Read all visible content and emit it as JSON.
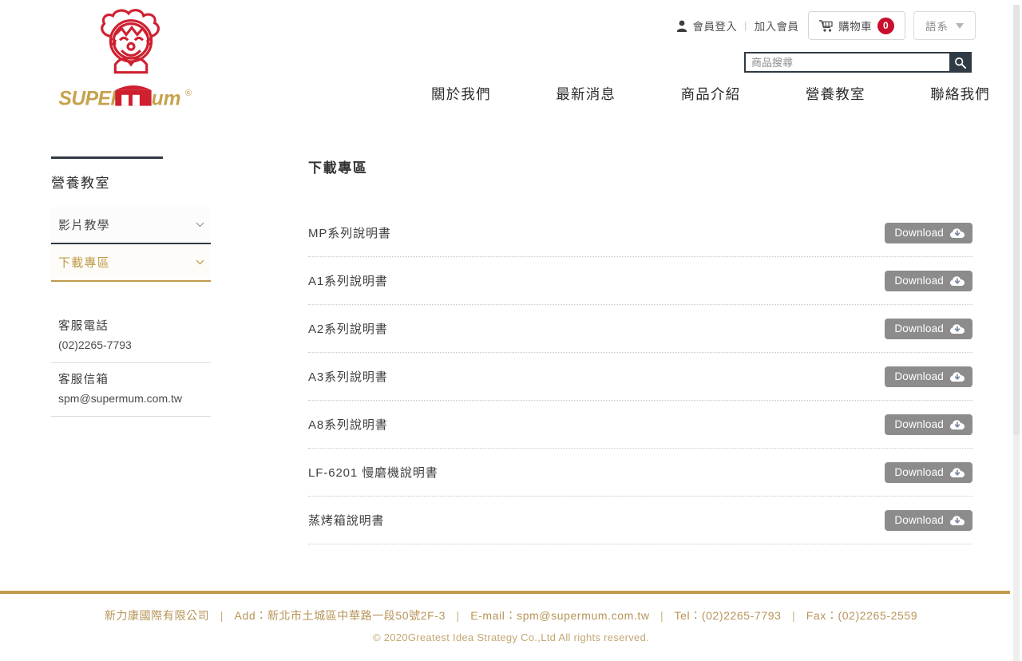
{
  "header": {
    "logo": {
      "brand": "SUPERMUM",
      "alt": "supermum-logo",
      "registered": "®"
    },
    "member": {
      "icon": "person-icon",
      "login_label": "會員登入",
      "separator": "|",
      "join_label": "加入會員"
    },
    "cart": {
      "icon": "cart-icon",
      "label": "購物車",
      "count": "0",
      "badge_color": "#c8102e"
    },
    "lang": {
      "label": "語系",
      "icon": "chevron-down-icon"
    },
    "search": {
      "placeholder": "商品搜尋",
      "value": "",
      "icon": "search-icon"
    },
    "nav": [
      {
        "label": "關於我們"
      },
      {
        "label": "最新消息"
      },
      {
        "label": "商品介紹"
      },
      {
        "label": "營養教室"
      },
      {
        "label": "聯絡我們"
      }
    ]
  },
  "sidebar": {
    "title": "營養教室",
    "accordion": [
      {
        "label": "影片教學",
        "active": false,
        "icon": "chevron-down-icon"
      },
      {
        "label": "下載專區",
        "active": true,
        "icon": "chevron-down-icon"
      }
    ],
    "contacts": [
      {
        "label": "客服電話",
        "value": "(02)2265-7793"
      },
      {
        "label": "客服信箱",
        "value": "spm@supermum.com.tw"
      }
    ]
  },
  "main": {
    "title": "下載專區",
    "download_button_label": "Download",
    "download_icon": "cloud-download-icon",
    "items": [
      {
        "name": "MP系列說明書"
      },
      {
        "name": "A1系列說明書"
      },
      {
        "name": "A2系列說明書"
      },
      {
        "name": "A3系列說明書"
      },
      {
        "name": "A8系列說明書"
      },
      {
        "name": "LF-6201 慢磨機說明書"
      },
      {
        "name": "蒸烤箱說明書"
      }
    ]
  },
  "footer": {
    "company": "新力康國際有限公司",
    "address_label": "Add：",
    "address": "新北市土城區中華路一段50號2F-3",
    "email_label": "E-mail：",
    "email": "spm@supermum.com.tw",
    "tel_label": "Tel：",
    "tel": "(02)2265-7793",
    "fax_label": "Fax：",
    "fax": "(02)2265-2559",
    "copyright": "© 2020Greatest Idea Strategy Co.,Ltd All rights reserved.",
    "accent_color": "#c09a4a"
  }
}
